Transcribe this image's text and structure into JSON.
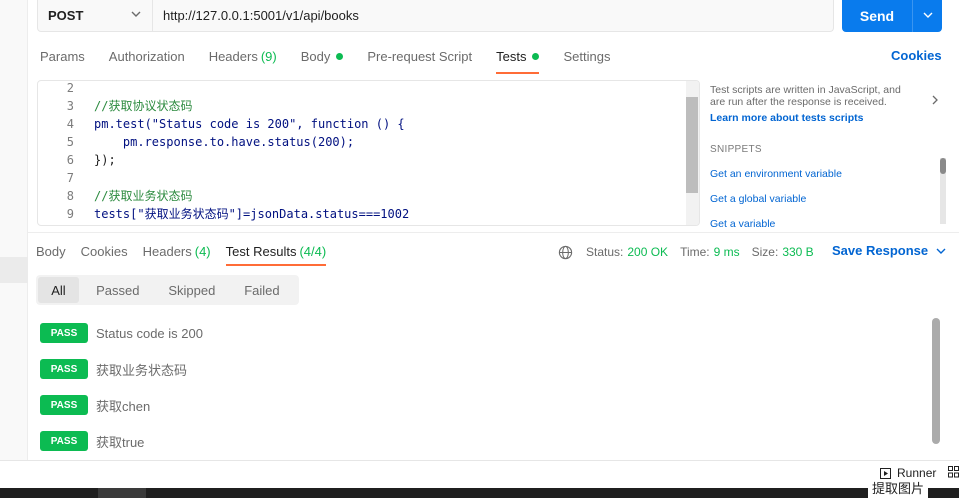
{
  "request": {
    "method": "POST",
    "url": "http://127.0.0.1:5001/v1/api/books",
    "send_label": "Send"
  },
  "request_tabs": [
    {
      "label": "Params"
    },
    {
      "label": "Authorization"
    },
    {
      "label": "Headers",
      "count": "(9)"
    },
    {
      "label": "Body"
    },
    {
      "label": "Pre-request Script"
    },
    {
      "label": "Tests"
    },
    {
      "label": "Settings"
    }
  ],
  "cookies_label": "Cookies",
  "editor": {
    "lines": [
      {
        "n": "2",
        "t": ""
      },
      {
        "n": "3",
        "t": "//获取协议状态码"
      },
      {
        "n": "4",
        "t": "pm.test(\"Status code is 200\", function () {"
      },
      {
        "n": "5",
        "t": "    pm.response.to.have.status(200);"
      },
      {
        "n": "6",
        "t": "});"
      },
      {
        "n": "7",
        "t": ""
      },
      {
        "n": "8",
        "t": "//获取业务状态码"
      },
      {
        "n": "9",
        "t": "tests[\"获取业务状态码\"]=jsonData.status===1002"
      }
    ]
  },
  "helper": {
    "description": "Test scripts are written in JavaScript, and are run after the response is received.",
    "learn_more": "Learn more about tests scripts",
    "snippets_title": "SNIPPETS",
    "snippets": [
      "Get an environment variable",
      "Get a global variable",
      "Get a variable"
    ]
  },
  "response_tabs": [
    {
      "label": "Body"
    },
    {
      "label": "Cookies"
    },
    {
      "label": "Headers",
      "count": "(4)"
    },
    {
      "label": "Test Results",
      "count": "(4/4)"
    }
  ],
  "status": {
    "status_label": "Status:",
    "status_value": "200 OK",
    "time_label": "Time:",
    "time_value": "9 ms",
    "size_label": "Size:",
    "size_value": "330 B",
    "save_label": "Save Response"
  },
  "filters": [
    "All",
    "Passed",
    "Skipped",
    "Failed"
  ],
  "results": [
    {
      "badge": "PASS",
      "name": "Status code is 200"
    },
    {
      "badge": "PASS",
      "name": "获取业务状态码"
    },
    {
      "badge": "PASS",
      "name": "获取chen"
    },
    {
      "badge": "PASS",
      "name": "获取true"
    }
  ],
  "footer": {
    "runner_label": "Runner",
    "cut_text": "提取图片"
  },
  "colors": {
    "accent_orange": "#ff6c37",
    "send_blue": "#097bed",
    "pass_green": "#0cbb52",
    "link_blue": "#0265d2"
  }
}
